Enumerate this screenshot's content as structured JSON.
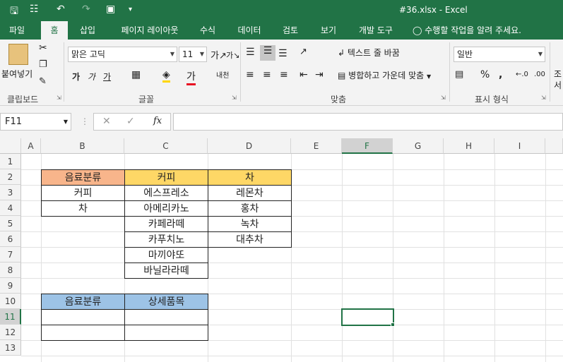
{
  "window": {
    "title": "#36.xlsx - Excel"
  },
  "tabs": [
    "파일",
    "홈",
    "삽입",
    "페이지 레이아웃",
    "수식",
    "데이터",
    "검토",
    "보기",
    "개발 도구"
  ],
  "tell_me": "수행할 작업을 알려 주세요.",
  "ribbon": {
    "paste_label": "붙여넣기",
    "font_name": "맑은 고딕",
    "font_size": "11",
    "wrap_text": "텍스트 줄 바꿈",
    "merge_center": "병합하고 가운데 맞춤",
    "number_format": "일반",
    "percent": "%",
    "comma": ",",
    "cond_label": "조",
    "cond_label2": "서",
    "groups": {
      "clipboard": "클립보드",
      "font": "글꼴",
      "alignment": "맞춤",
      "number": "표시 형식"
    }
  },
  "formula": {
    "name_box": "F11",
    "value": ""
  },
  "columns": [
    "A",
    "B",
    "C",
    "D",
    "E",
    "F",
    "G",
    "H",
    "I"
  ],
  "rows": [
    "1",
    "2",
    "3",
    "4",
    "5",
    "6",
    "7",
    "8",
    "9",
    "10",
    "11",
    "12",
    "13"
  ],
  "table1": {
    "header_b": "음료분류",
    "header_c": "커피",
    "header_d": "차",
    "b": [
      "커피",
      "차"
    ],
    "c": [
      "에스프레소",
      "아메리카노",
      "카페라떼",
      "카푸치노",
      "마끼야또",
      "바닐라라떼"
    ],
    "d": [
      "레몬차",
      "홍차",
      "녹차",
      "대추차"
    ]
  },
  "table2": {
    "header_b": "음료분류",
    "header_c": "상세품목"
  },
  "colors": {
    "excel_green": "#217346",
    "orange": "#f8b58b",
    "yellow": "#fed766",
    "blue": "#9dc3e6"
  }
}
